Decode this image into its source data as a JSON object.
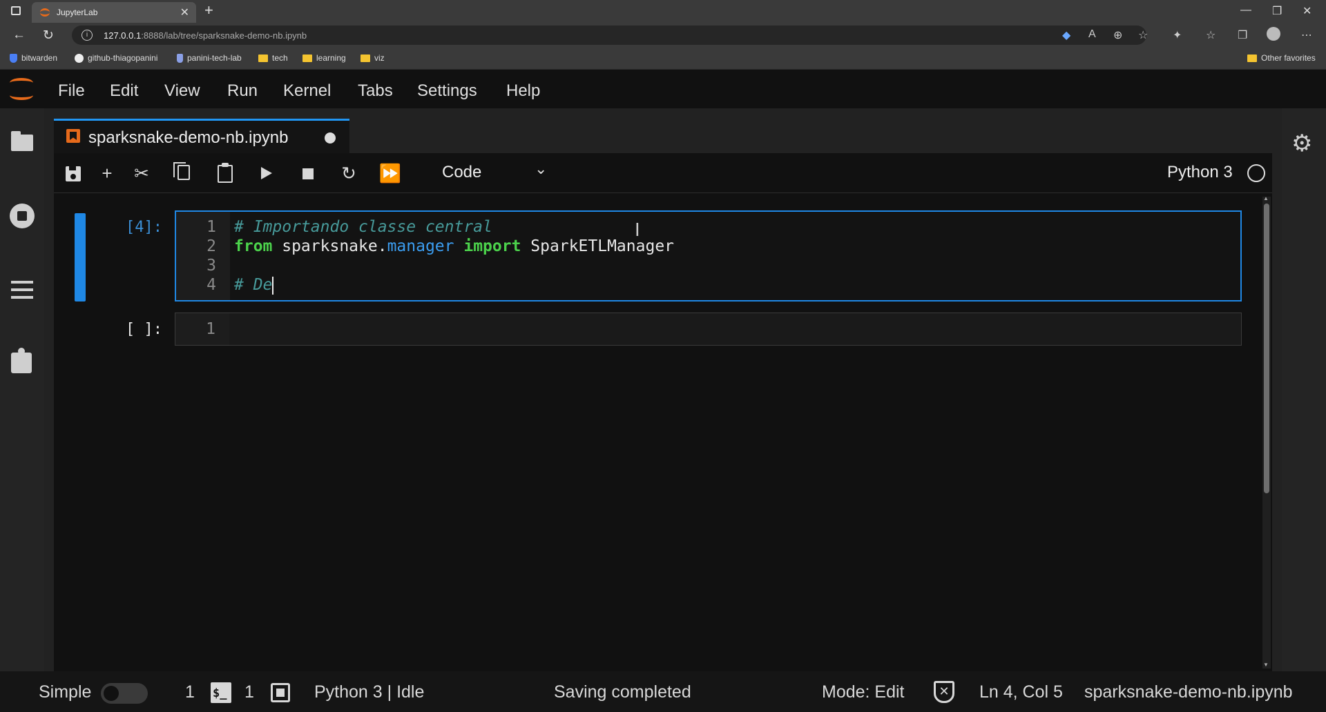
{
  "browser": {
    "tab_title": "JupyterLab",
    "url_host": "127.0.0.1",
    "url_rest": ":8888/lab/tree/sparksnake-demo-nb.ipynb",
    "bookmarks": [
      "bitwarden",
      "github-thiagopanini",
      "panini-tech-lab",
      "tech",
      "learning",
      "viz"
    ],
    "other_favorites": "Other favorites"
  },
  "menu": {
    "items": [
      "File",
      "Edit",
      "View",
      "Run",
      "Kernel",
      "Tabs",
      "Settings",
      "Help"
    ]
  },
  "document": {
    "tab_name": "sparksnake-demo-nb.ipynb"
  },
  "toolbar": {
    "cell_type": "Code",
    "kernel_name": "Python 3"
  },
  "cells": [
    {
      "prompt": "[4]:",
      "lines": [
        {
          "num": "1",
          "tokens": [
            {
              "t": "# Importando classe central",
              "c": "cmt"
            }
          ]
        },
        {
          "num": "2",
          "tokens": [
            {
              "t": "from",
              "c": "kw"
            },
            {
              "t": " sparksnake.",
              "c": "plain"
            },
            {
              "t": "manager",
              "c": "attr"
            },
            {
              "t": " ",
              "c": "plain"
            },
            {
              "t": "import",
              "c": "kw"
            },
            {
              "t": " SparkETLManager",
              "c": "plain"
            }
          ]
        },
        {
          "num": "3",
          "tokens": []
        },
        {
          "num": "4",
          "tokens": [
            {
              "t": "# De",
              "c": "cmt"
            }
          ]
        }
      ]
    },
    {
      "prompt": "[ ]:",
      "lines": [
        {
          "num": "1",
          "tokens": []
        }
      ]
    }
  ],
  "status": {
    "mode_label": "Simple",
    "terminals_count": "1",
    "kernels_count": "1",
    "kernel_status": "Python 3 | Idle",
    "save_message": "Saving completed",
    "mode": "Mode: Edit",
    "cursor_position": "Ln 4, Col 5",
    "file_name": "sparksnake-demo-nb.ipynb"
  },
  "colors": {
    "accent": "#1f88e5",
    "jupyter_orange": "#e66a1b",
    "comment": "#479a9a",
    "keyword": "#4bd14b",
    "attribute": "#3b9df0"
  }
}
